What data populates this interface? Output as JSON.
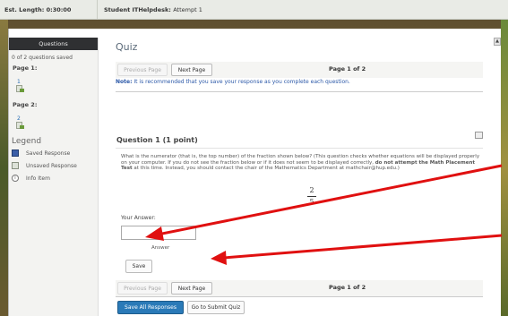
{
  "topbar": {
    "est_length": "Est. Length: 0:30:00",
    "attempt_user": "Student ITHelpdesk:",
    "attempt_num": "Attempt 1"
  },
  "sidebar": {
    "header": "Questions",
    "saved_count": "0 of 2 questions saved",
    "pages": [
      {
        "label": "Page 1:",
        "question": "1"
      },
      {
        "label": "Page 2:",
        "question": "2"
      }
    ],
    "legend_title": "Legend",
    "legend": [
      {
        "label": "Saved Response"
      },
      {
        "label": "Unsaved Response"
      },
      {
        "label": "Info Item"
      }
    ]
  },
  "main": {
    "title": "Quiz",
    "prev_page": "Previous Page",
    "next_page": "Next Page",
    "page_info": "Page 1 of 2",
    "note_label": "Note:",
    "note_text": " It is recommended that you save your response as you complete each question.",
    "question_title": "Question 1",
    "question_points": "(1 point)",
    "question_text_1": "What is the numerator (that is, the top number) of the fraction shown below?  (This question checks whether equations will be displayed properly on your computer.  If you do not see the fraction below or if it does not seem to be displayed correctly, ",
    "question_text_bold": "do not attempt the Math Placement Test",
    "question_text_2": " at this time.  Instead, you should contact the chair of the Mathematics Department at mathchair@hup.edu.)",
    "fraction_num": "2",
    "fraction_den": "5",
    "answer_label": "Your Answer:",
    "answer_value": "",
    "answer_tag": "Answer",
    "save_button": "Save",
    "save_all": "Save All Responses",
    "submit_quiz": "Go to Submit Quiz"
  },
  "colors": {
    "accent": "#2a6fb5",
    "save_all_bg": "#2a7ab8",
    "arrow": "#e01010"
  }
}
